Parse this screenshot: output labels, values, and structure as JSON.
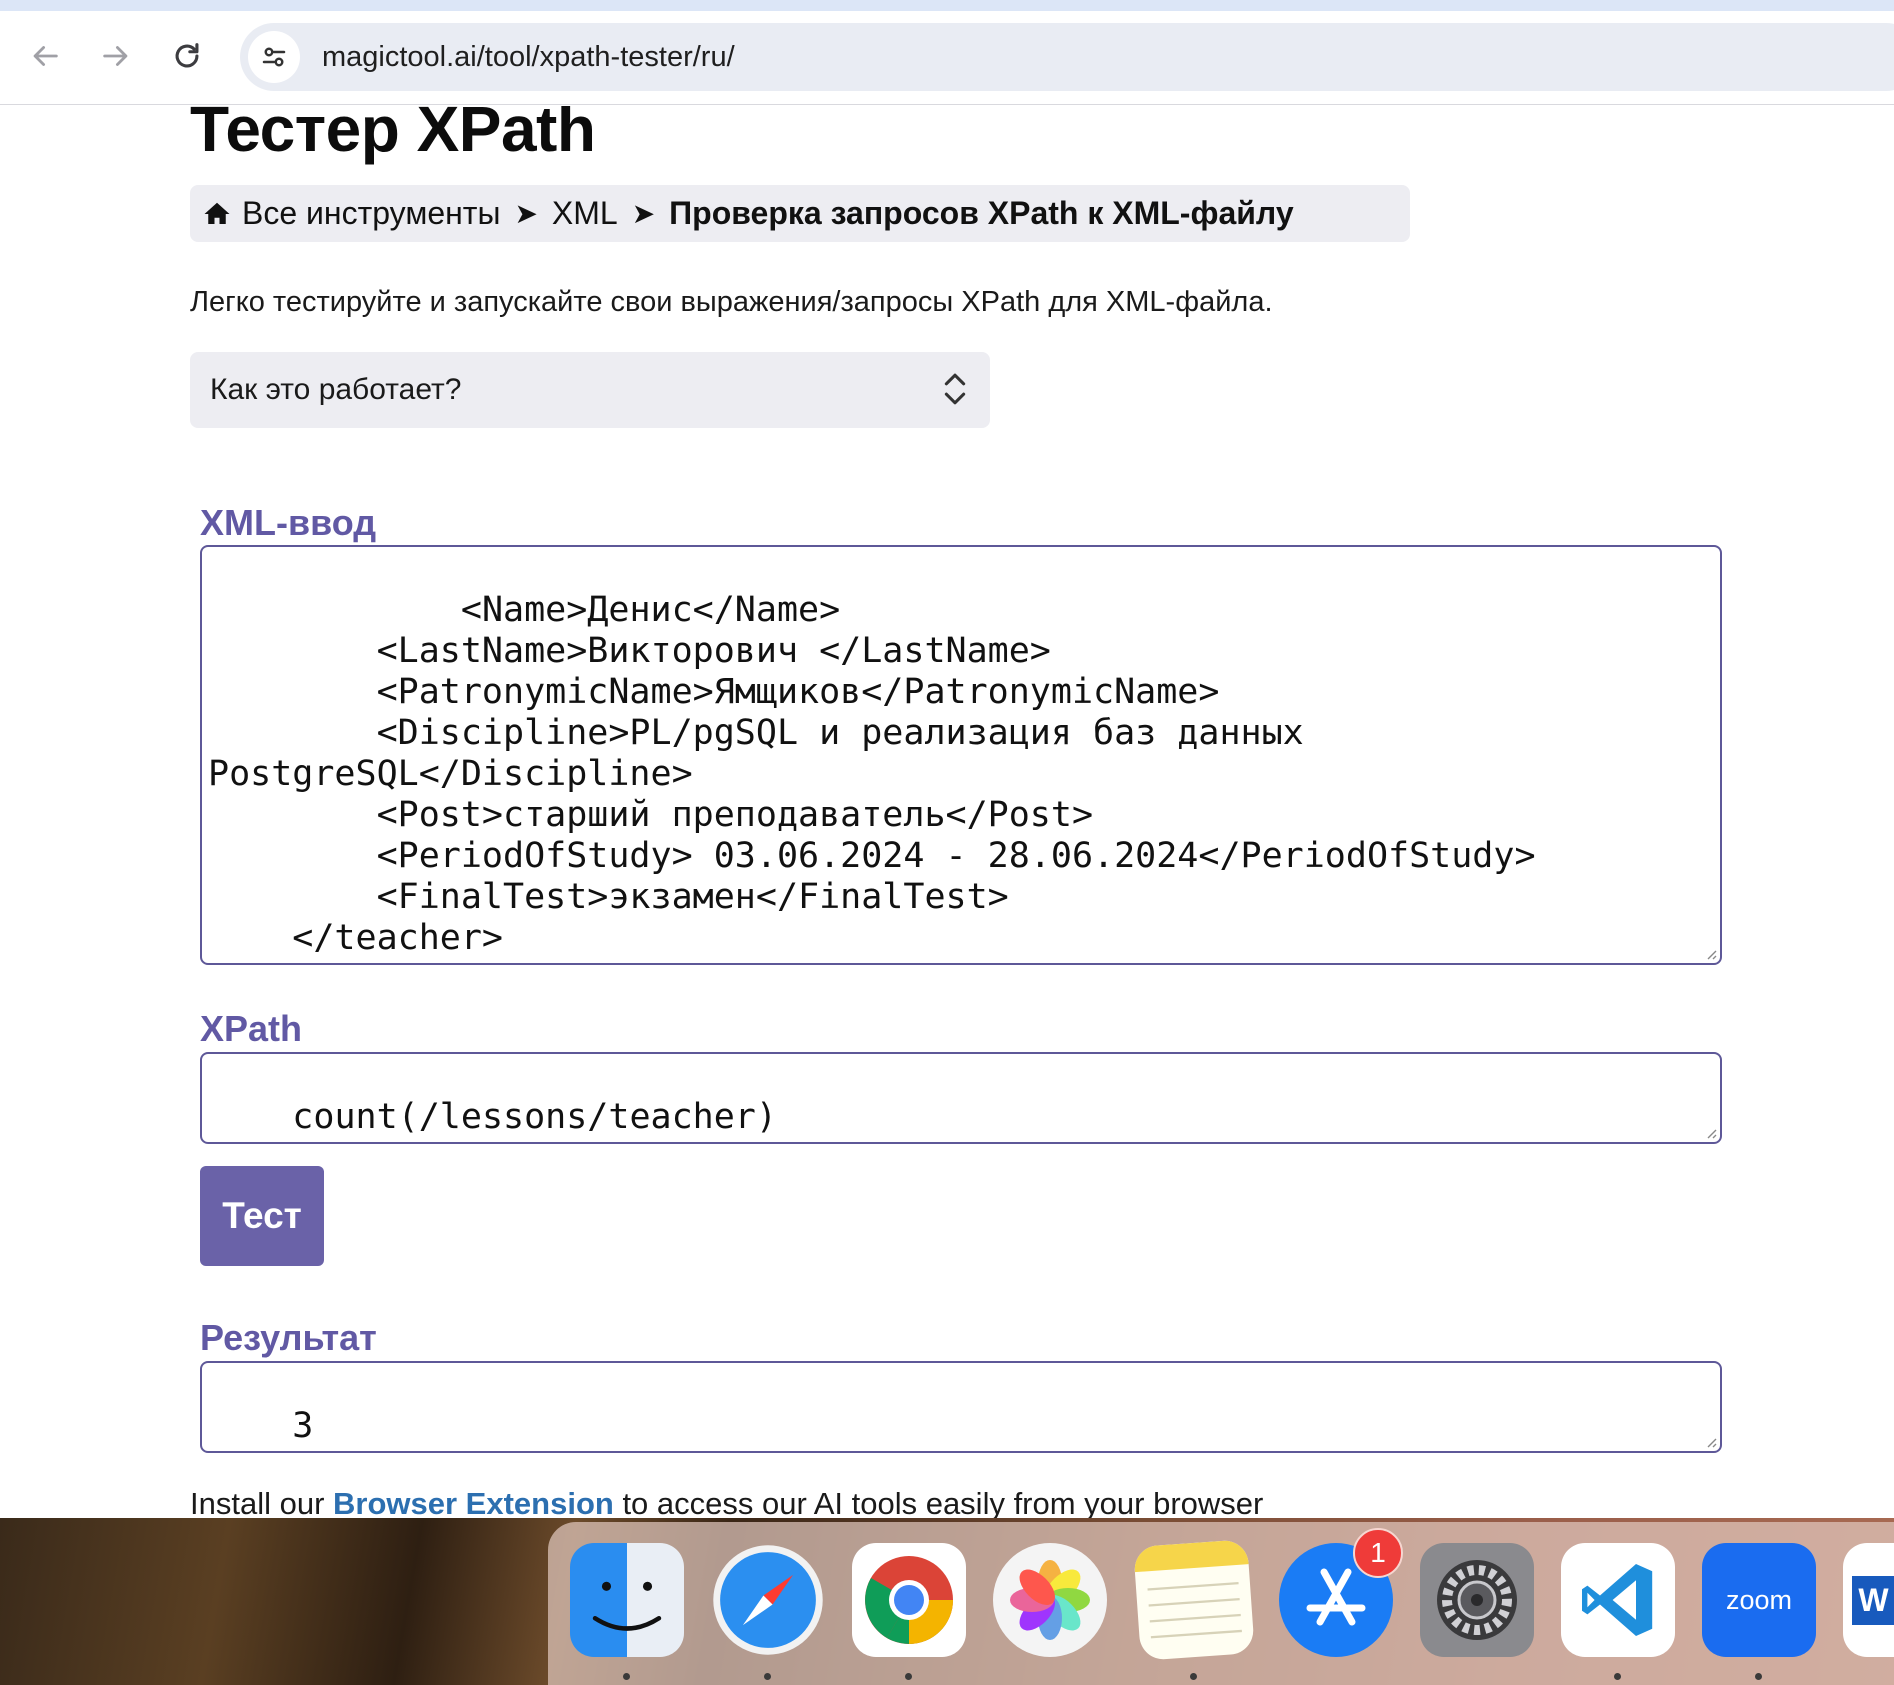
{
  "browser": {
    "url": "magictool.ai/tool/xpath-tester/ru/"
  },
  "page": {
    "title": "Тестер XPath",
    "breadcrumb": {
      "items": [
        "Все инструменты",
        "XML"
      ],
      "separator": "➤",
      "current": "Проверка запросов XPath к XML-файлу"
    },
    "description": "Легко тестируйте и запускайте свои выражения/запросы XPath для XML-файла.",
    "how_it_works": "Как это работает?",
    "xml_input": {
      "label": "XML-ввод",
      "value": "        <Name>Денис</Name>\n        <LastName>Викторович </LastName>\n        <PatronymicName>Ямщиков</PatronymicName>\n        <Discipline>PL/pgSQL и реализация баз данных\nPostgreSQL</Discipline>\n        <Post>старший преподаватель</Post>\n        <PeriodOfStudy> 03.06.2024 - 28.06.2024</PeriodOfStudy>\n        <FinalTest>экзамен</FinalTest>\n    </teacher>\n</lessons>"
    },
    "xpath": {
      "label": "XPath",
      "value": "count(/lessons/teacher)"
    },
    "test_button": "Тест",
    "result": {
      "label": "Результат",
      "value": "3"
    },
    "install": {
      "prefix": "Install our ",
      "link": "Browser Extension",
      "suffix": " to access our AI tools easily from your browser"
    }
  },
  "dock": {
    "apps": [
      "finder-icon",
      "safari-icon",
      "chrome-icon",
      "photos-icon",
      "notes-icon",
      "app-store-icon",
      "system-settings-icon",
      "vscode-icon",
      "zoom-icon",
      "word-icon"
    ],
    "app_store_badge": "1",
    "zoom_label": "zoom",
    "word_letter": "W"
  },
  "colors": {
    "accent": "#6a62a8",
    "label": "#6159a4",
    "link": "#2c6fb0"
  }
}
